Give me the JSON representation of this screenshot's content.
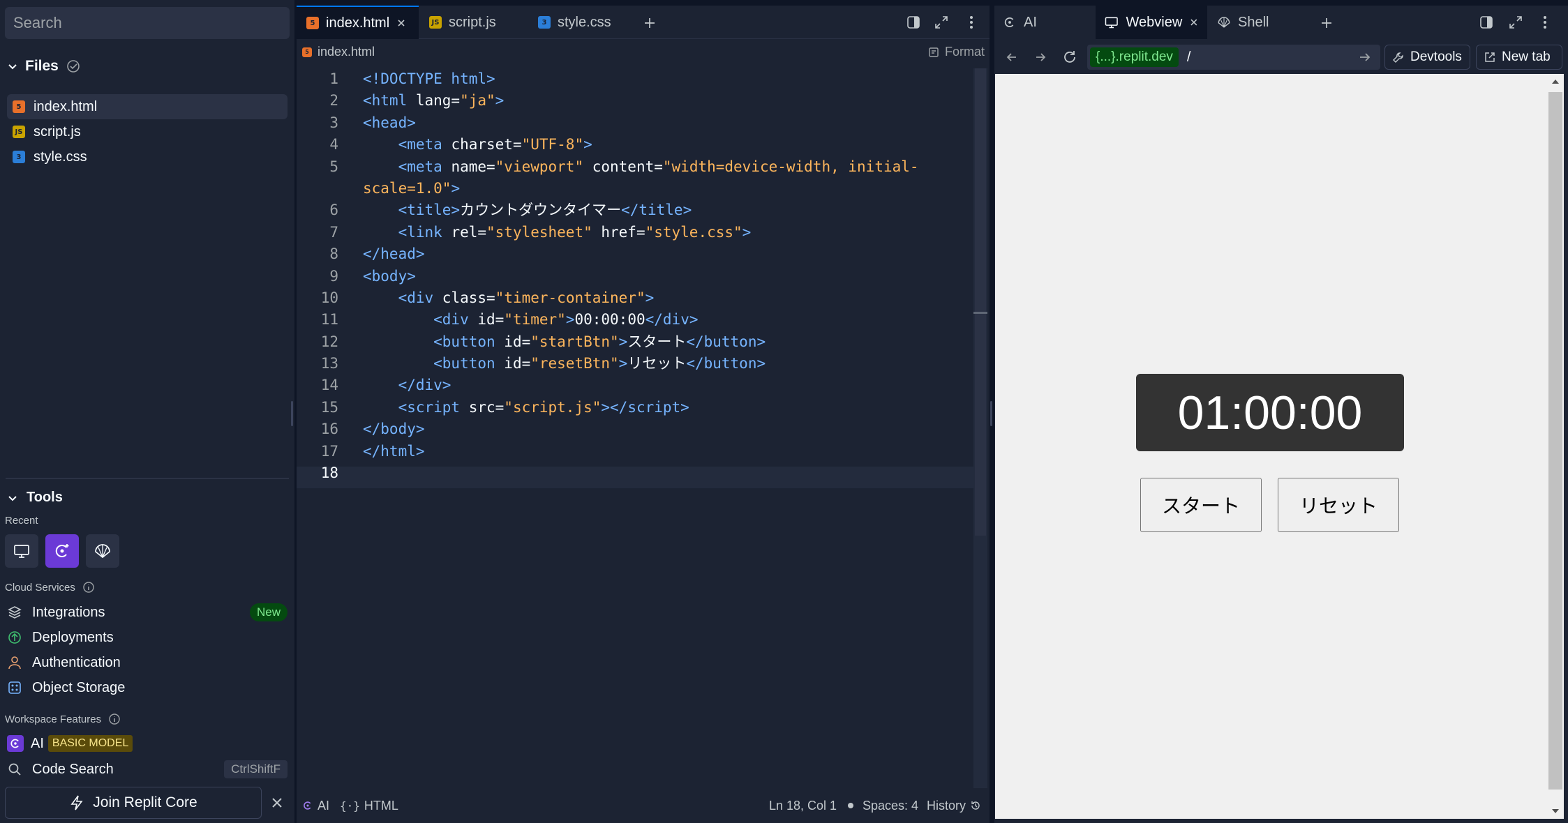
{
  "sidebar": {
    "search_placeholder": "Search",
    "files_title": "Files",
    "files": [
      {
        "name": "index.html",
        "type": "html",
        "active": true
      },
      {
        "name": "script.js",
        "type": "js",
        "active": false
      },
      {
        "name": "style.css",
        "type": "css",
        "active": false
      }
    ],
    "tools_title": "Tools",
    "recent_label": "Recent",
    "cloud_services_label": "Cloud Services",
    "services": [
      {
        "label": "Integrations",
        "badge": "New",
        "icon": "layers-icon"
      },
      {
        "label": "Deployments",
        "icon": "deployments-icon"
      },
      {
        "label": "Authentication",
        "icon": "user-icon"
      },
      {
        "label": "Object Storage",
        "icon": "storage-icon"
      }
    ],
    "workspace_features_label": "Workspace Features",
    "ai_label": "AI",
    "ai_badge": "BASIC MODEL",
    "code_search_label": "Code Search",
    "code_search_shortcut": "CtrlShiftF",
    "join_label": "Join Replit Core"
  },
  "editor": {
    "tabs": [
      {
        "label": "index.html",
        "active": true
      },
      {
        "label": "script.js",
        "active": false
      },
      {
        "label": "style.css",
        "active": false
      }
    ],
    "breadcrumb": "index.html",
    "format_label": "Format",
    "line_numbers": [
      "1",
      "2",
      "3",
      "4",
      "5",
      "",
      "6",
      "7",
      "8",
      "9",
      "10",
      "11",
      "12",
      "13",
      "14",
      "15",
      "16",
      "17",
      "18"
    ],
    "status": {
      "ai": "AI",
      "language": "HTML",
      "position": "Ln 18, Col 1",
      "spaces": "Spaces: 4",
      "history": "History"
    }
  },
  "code": {
    "l1": "<!DOCTYPE html>",
    "l2a": "<html",
    "l2b": " lang=",
    "l2c": "\"ja\"",
    "l2d": ">",
    "l3": "<head>",
    "l4a": "    <meta",
    "l4b": " charset=",
    "l4c": "\"UTF-8\"",
    "l4d": ">",
    "l5a": "    <meta",
    "l5b": " name=",
    "l5c": "\"viewport\"",
    "l5d": " content=",
    "l5e": "\"width=device-width, initial-",
    "l5f": "scale=1.0\"",
    "l5g": ">",
    "l6a": "    <title>",
    "l6b": "カウントダウンタイマー",
    "l6c": "</title>",
    "l7a": "    <link",
    "l7b": " rel=",
    "l7c": "\"stylesheet\"",
    "l7d": " href=",
    "l7e": "\"style.css\"",
    "l7f": ">",
    "l8": "</head>",
    "l9": "<body>",
    "l10a": "    <div",
    "l10b": " class=",
    "l10c": "\"timer-container\"",
    "l10d": ">",
    "l11a": "        <div",
    "l11b": " id=",
    "l11c": "\"timer\"",
    "l11d": ">",
    "l11e": "00:00:00",
    "l11f": "</div>",
    "l12a": "        <button",
    "l12b": " id=",
    "l12c": "\"startBtn\"",
    "l12d": ">",
    "l12e": "スタート",
    "l12f": "</button>",
    "l13a": "        <button",
    "l13b": " id=",
    "l13c": "\"resetBtn\"",
    "l13d": ">",
    "l13e": "リセット",
    "l13f": "</button>",
    "l14": "    </div>",
    "l15a": "    <script",
    "l15b": " src=",
    "l15c": "\"script.js\"",
    "l15d": "></",
    "l15e": "script",
    "l15f": ">",
    "l16": "</body>",
    "l17": "</html>"
  },
  "right_pane": {
    "tabs": [
      {
        "label": "AI",
        "active": false
      },
      {
        "label": "Webview",
        "active": true
      },
      {
        "label": "Shell",
        "active": false
      }
    ],
    "url_pill": "{...}.replit.dev",
    "url_path": "/",
    "devtools_label": "Devtools",
    "new_tab_label": "New tab"
  },
  "webview": {
    "timer": "01:00:00",
    "start_label": "スタート",
    "reset_label": "リセット"
  }
}
